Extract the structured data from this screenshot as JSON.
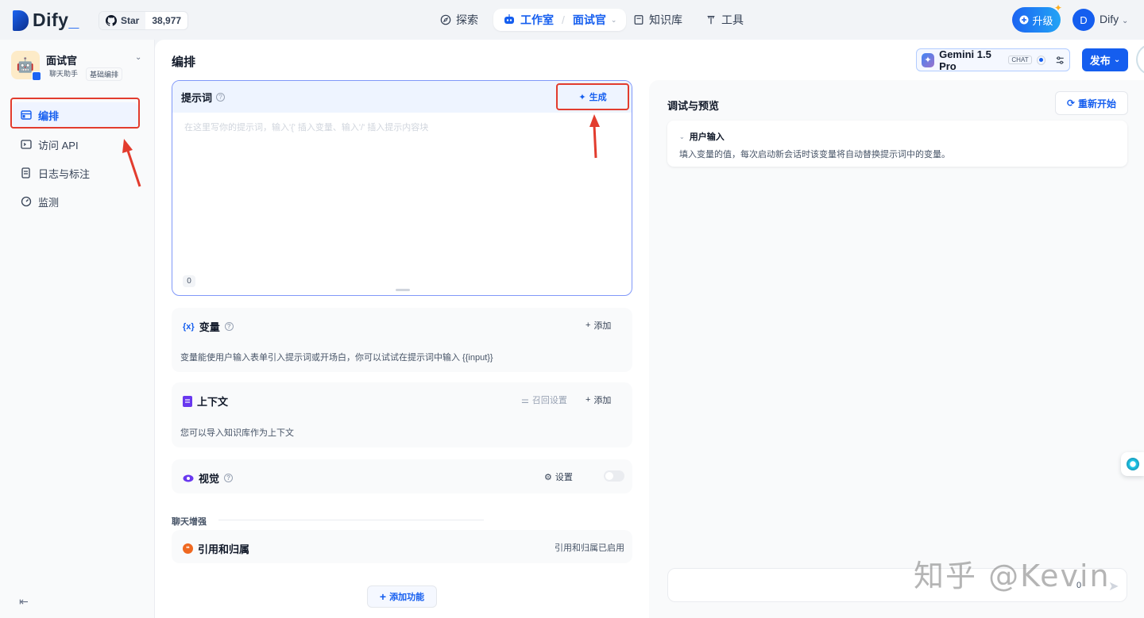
{
  "header": {
    "logo_text": "Dify",
    "github_star_label": "Star",
    "github_star_count": "38,977",
    "nav": {
      "explore": "探索",
      "studio": "工作室",
      "current_app": "面试官",
      "knowledge": "知识库",
      "tools": "工具"
    },
    "upgrade_label": "升级",
    "avatar_initial": "D",
    "user_name": "Dify"
  },
  "sidebar": {
    "app_name": "面试官",
    "app_tags": [
      "聊天助手",
      "基础编排"
    ],
    "items": [
      {
        "label": "编排",
        "icon": "layout-icon",
        "active": true
      },
      {
        "label": "访问 API",
        "icon": "terminal-icon",
        "active": false
      },
      {
        "label": "日志与标注",
        "icon": "document-icon",
        "active": false
      },
      {
        "label": "监测",
        "icon": "gauge-icon",
        "active": false
      }
    ]
  },
  "main": {
    "title": "编排",
    "model": {
      "name": "Gemini 1.5 Pro",
      "mode_tag": "CHAT"
    },
    "publish_label": "发布",
    "prompt": {
      "title": "提示词",
      "generate_label": "生成",
      "placeholder": "在这里写你的提示词，输入'{' 插入变量、输入'/' 插入提示内容块",
      "char_count": "0"
    },
    "variables": {
      "title": "变量",
      "add_label": "添加",
      "description": "变量能使用户输入表单引入提示词或开场白，你可以试试在提示词中输入 {{input}}"
    },
    "context": {
      "title": "上下文",
      "recall_label": "召回设置",
      "add_label": "添加",
      "description": "您可以导入知识库作为上下文"
    },
    "vision": {
      "title": "视觉",
      "settings_label": "设置",
      "enabled": false
    },
    "chat_enhance_label": "聊天增强",
    "citation": {
      "title": "引用和归属",
      "status": "引用和归属已启用"
    },
    "add_feature_label": "添加功能"
  },
  "debug": {
    "title": "调试与预览",
    "restart_label": "重新开始",
    "user_input_title": "用户输入",
    "user_input_desc": "填入变量的值，每次启动新会话时该变量将自动替换提示词中的变量。",
    "chat_char_count": "0"
  },
  "watermark": "知乎 @Kevin",
  "colors": {
    "accent": "#155eef",
    "annotation_red": "#e23c2e",
    "prompt_border": "#8098f9"
  }
}
